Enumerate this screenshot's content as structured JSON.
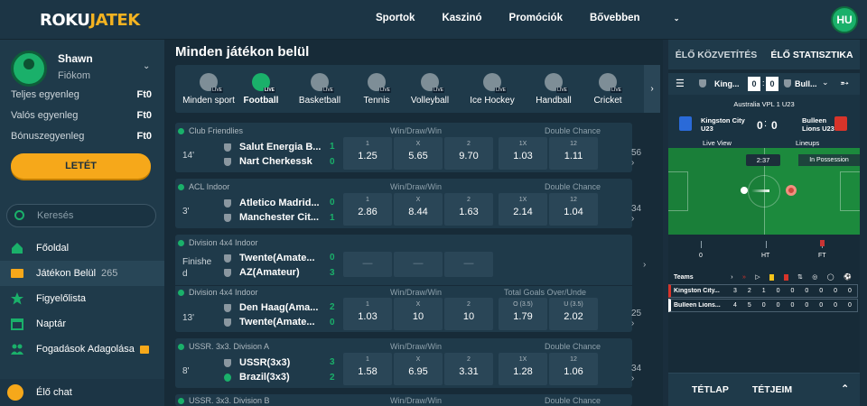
{
  "brand": {
    "logo_part1": "ROKU",
    "logo_part2": "JATEK"
  },
  "nav": {
    "items": [
      "Sportok",
      "Kaszinó",
      "Promóciók",
      "Bővebben"
    ]
  },
  "user": {
    "initials": "HU",
    "name": "Shawn",
    "account_label": "Fiókom"
  },
  "balances": [
    {
      "label": "Teljes egyenleg",
      "value": "Ft0"
    },
    {
      "label": "Valós egyenleg",
      "value": "Ft0"
    },
    {
      "label": "Bónuszegyenleg",
      "value": "Ft0"
    }
  ],
  "deposit_label": "LETÉT",
  "search": {
    "placeholder": "Keresés"
  },
  "menu": [
    {
      "label": "Főoldal"
    },
    {
      "label": "Játékon Belül",
      "count": "265"
    },
    {
      "label": "Figyelőlista"
    },
    {
      "label": "Naptár"
    },
    {
      "label": "Fogadások Adagolása"
    }
  ],
  "chat_label": "Élő chat",
  "main": {
    "title": "Minden játékon belül",
    "sports": [
      "Minden sport",
      "Football",
      "Basketball",
      "Tennis",
      "Volleyball",
      "Ice Hockey",
      "Handball",
      "Cricket"
    ]
  },
  "matches": [
    {
      "league": "Club Friendlies",
      "market1": "Win/Draw/Win",
      "market2": "Double Chance",
      "time": "14'",
      "home": "Salut Energia B...",
      "away": "Nart Cherkessk",
      "home_score": "1",
      "away_score": "0",
      "odds": [
        {
          "l": "1",
          "v": "1.25"
        },
        {
          "l": "X",
          "v": "5.65"
        },
        {
          "l": "2",
          "v": "9.70"
        },
        {
          "l": "1X",
          "v": "1.03"
        },
        {
          "l": "12",
          "v": "1.11"
        }
      ],
      "more": "56"
    },
    {
      "league": "ACL Indoor",
      "market1": "Win/Draw/Win",
      "market2": "Double Chance",
      "time": "3'",
      "home": "Atletico Madrid...",
      "away": "Manchester Cit...",
      "home_score": "0",
      "away_score": "1",
      "odds": [
        {
          "l": "1",
          "v": "2.86"
        },
        {
          "l": "X",
          "v": "8.44"
        },
        {
          "l": "2",
          "v": "1.63"
        },
        {
          "l": "1X",
          "v": "2.14"
        },
        {
          "l": "12",
          "v": "1.04"
        }
      ],
      "more": "34"
    },
    {
      "league": "Division 4x4 Indoor",
      "market1": "",
      "market2": "",
      "time": "Finishe d",
      "home": "Twente(Amate...",
      "away": "AZ(Amateur)",
      "home_score": "0",
      "away_score": "3",
      "odds": [
        {
          "l": "",
          "v": "—"
        },
        {
          "l": "",
          "v": "—"
        },
        {
          "l": "",
          "v": "—"
        }
      ],
      "more": ""
    },
    {
      "league": "Division 4x4 Indoor",
      "market1": "Win/Draw/Win",
      "market2": "Total Goals Over/Unde",
      "time": "13'",
      "home": "Den Haag(Ama...",
      "away": "Twente(Amate...",
      "home_score": "2",
      "away_score": "0",
      "odds": [
        {
          "l": "1",
          "v": "1.03"
        },
        {
          "l": "X",
          "v": "10"
        },
        {
          "l": "2",
          "v": "10"
        },
        {
          "l": "O (3.5)",
          "v": "1.79"
        },
        {
          "l": "U (3.5)",
          "v": "2.02"
        }
      ],
      "more": "25"
    },
    {
      "league": "USSR. 3x3. Division A",
      "market1": "Win/Draw/Win",
      "market2": "Double Chance",
      "time": "8'",
      "home": "USSR(3x3)",
      "away": "Brazil(3x3)",
      "home_score": "3",
      "away_score": "2",
      "odds": [
        {
          "l": "1",
          "v": "1.58"
        },
        {
          "l": "X",
          "v": "6.95"
        },
        {
          "l": "2",
          "v": "3.31"
        },
        {
          "l": "1X",
          "v": "1.28"
        },
        {
          "l": "12",
          "v": "1.06"
        }
      ],
      "more": "34"
    },
    {
      "league": "USSR. 3x3. Division B",
      "market1": "Win/Draw/Win",
      "market2": "Double Chance"
    }
  ],
  "right": {
    "tab_live": "ÉLŐ KÖZVETÍTÉS",
    "tab_stats": "ÉLŐ STATISZTIKA",
    "bar_home": "King...",
    "bar_away": "Bull...",
    "bar_home_score": "0",
    "bar_away_score": "0",
    "competition": "Australia VPL 1 U23",
    "home_team": "Kingston City U23",
    "away_team": "Bulleen Lions U23",
    "home_score": "0",
    "away_score": "0",
    "live_view": "Live View",
    "lineups": "Lineups",
    "clock": "2:37",
    "possession": "In Possession",
    "timeline": [
      "0",
      "HT",
      "FT"
    ],
    "stats_header": "Teams",
    "stats_rows": [
      {
        "team": "Kingston City...",
        "vals": [
          "3",
          "2",
          "1",
          "0",
          "0",
          "0",
          "0",
          "0",
          "0"
        ]
      },
      {
        "team": "Bulleen Lions...",
        "vals": [
          "4",
          "5",
          "0",
          "0",
          "0",
          "0",
          "0",
          "0",
          "0"
        ]
      }
    ],
    "betslip_tab": "TÉTLAP",
    "mybets_tab": "TÉTJEIM"
  }
}
